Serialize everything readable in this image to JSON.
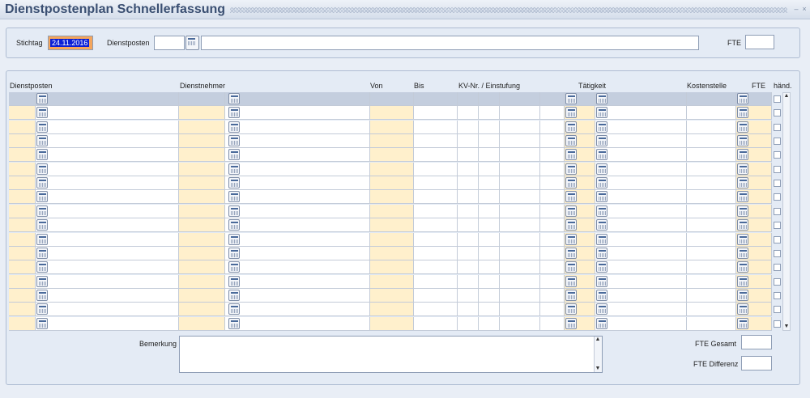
{
  "window": {
    "title": "Dienstpostenplan Schnellerfassung",
    "minimize_glyph": "–",
    "close_glyph": "×"
  },
  "header": {
    "stichtag_label": "Stichtag",
    "stichtag_value": "24.11.2016",
    "dienstposten_label": "Dienstposten",
    "dienstposten_code": "",
    "dienstposten_text": "",
    "fte_label": "FTE",
    "fte_value": ""
  },
  "table": {
    "columns": {
      "dienstposten": "Dienstposten",
      "dienstnehmer": "Dienstnehmer",
      "von": "Von",
      "bis": "Bis",
      "kv": "KV-Nr. / Einstufung",
      "taetigkeit": "Tätigkeit",
      "kostenstelle": "Kostenstelle",
      "fte": "FTE",
      "haend": "händ."
    },
    "row_count": 17,
    "current_row": 0
  },
  "footer": {
    "bemerkung_label": "Bemerkung",
    "bemerkung_value": "",
    "fte_gesamt_label": "FTE Gesamt",
    "fte_gesamt_value": "",
    "fte_differenz_label": "FTE Differenz",
    "fte_differenz_value": ""
  },
  "colors": {
    "accent_title": "#3a4f72",
    "required_field": "#fff0cc",
    "selection": "#0a1fd6",
    "current_row": "#c4cede"
  },
  "icons": {
    "lov_button": "list-of-values-icon",
    "scroll_up": "▲",
    "scroll_down": "▼"
  }
}
